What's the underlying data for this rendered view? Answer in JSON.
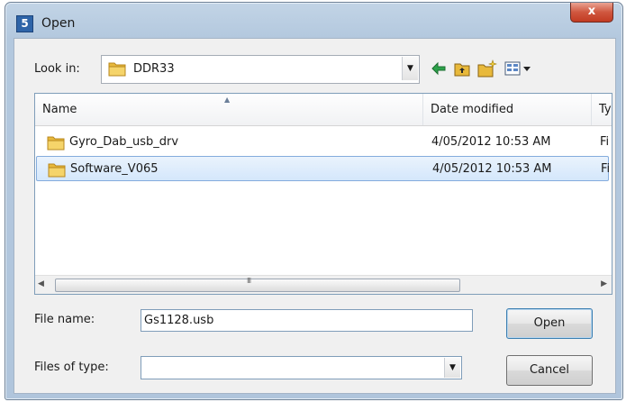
{
  "window": {
    "title": "Open",
    "app_icon_letter": "5",
    "close_label": "x"
  },
  "lookin": {
    "label": "Look in:",
    "value": "DDR33"
  },
  "toolbar": {
    "back_icon": "back-arrow-icon",
    "up_icon": "up-folder-icon",
    "new_folder_icon": "new-folder-icon",
    "view_icon": "view-menu-icon"
  },
  "list": {
    "columns": {
      "name": "Name",
      "date": "Date modified",
      "type": "Ty"
    },
    "rows": [
      {
        "name": "Gyro_Dab_usb_drv",
        "date": "4/05/2012 10:53 AM",
        "type": "Fi",
        "selected": false
      },
      {
        "name": "Software_V065",
        "date": "4/05/2012 10:53 AM",
        "type": "Fi",
        "selected": true
      }
    ],
    "scroll_grip": "III"
  },
  "file_name": {
    "label": "File name:",
    "value": "Gs1128.usb"
  },
  "file_type": {
    "label": "Files of type:",
    "value": ""
  },
  "buttons": {
    "open": "Open",
    "cancel": "Cancel"
  },
  "colors": {
    "selection": "#d4e7fb",
    "folder": "#e8b93b",
    "list_border": "#7f9db9"
  }
}
